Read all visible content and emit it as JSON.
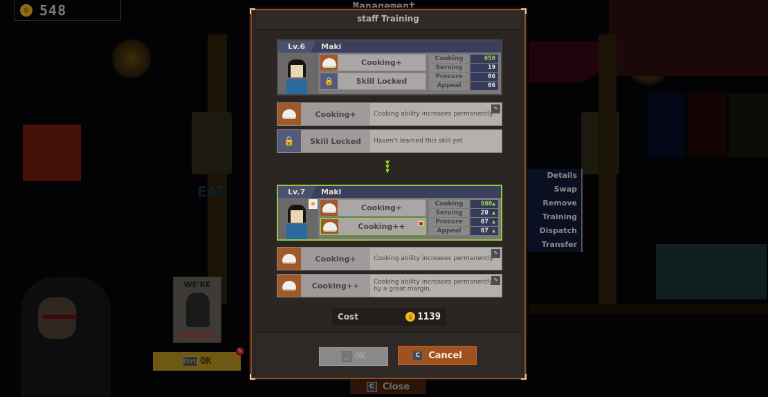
{
  "hud": {
    "coins": "548",
    "coin_icon": "$"
  },
  "background": {
    "top_title": "Management"
  },
  "modal": {
    "title": "staff Training",
    "current": {
      "level": "Lv.6",
      "name": "Maki",
      "skills": [
        {
          "label": "Cooking+",
          "icon": "steamed-bun-icon"
        },
        {
          "label": "Skill Locked",
          "icon": "lock-icon"
        }
      ],
      "stats": [
        {
          "label": "Cooking",
          "value": "650"
        },
        {
          "label": "Serving",
          "value": "19"
        },
        {
          "label": "Procure",
          "value": "06"
        },
        {
          "label": "Appeal",
          "value": "06"
        }
      ]
    },
    "current_details": [
      {
        "name": "Cooking+",
        "desc": "Cooking ability increases permanently."
      },
      {
        "name": "Skill Locked",
        "desc": "Haven't learned this skill yet"
      }
    ],
    "arrow": "»",
    "next": {
      "level": "Lv.7",
      "name": "Maki",
      "skills": [
        {
          "label": "Cooking+",
          "icon": "steamed-bun-icon"
        },
        {
          "label": "Cooking++",
          "icon": "steamed-bun-icon",
          "new": "N"
        }
      ],
      "stats": [
        {
          "label": "Cooking",
          "value": "800",
          "up": "▲"
        },
        {
          "label": "Serving",
          "value": "20",
          "up": "▲"
        },
        {
          "label": "Procure",
          "value": "07",
          "up": "▲"
        },
        {
          "label": "Appeal",
          "value": "07",
          "up": "▲"
        }
      ]
    },
    "next_details": [
      {
        "name": "Cooking+",
        "desc": "Cooking ability increases permanently."
      },
      {
        "name": "Cooking++",
        "desc": "Cooking ability increases permanently by a great margin."
      }
    ],
    "cost": {
      "label": "Cost",
      "value": "1139",
      "coin_icon": "$"
    },
    "ok": {
      "key": "⎵",
      "label": "OK"
    },
    "cancel": {
      "key": "C",
      "label": "Cancel"
    }
  },
  "close": {
    "key": "C",
    "label": "Close"
  },
  "context_menu": {
    "items": [
      "Details",
      "Swap",
      "Remove",
      "Training",
      "Dispatch",
      "Transfer"
    ]
  },
  "poster": {
    "line1": "WE'RE",
    "line2": "HIRING!"
  },
  "hire_button": {
    "key": "Ctrl",
    "label": "OK",
    "badge": "N"
  },
  "colors": {
    "accent_green": "#90cc3c",
    "cancel_orange": "#a0521e",
    "modal_border": "#8a4e22",
    "stat_value_bg": "#353a5a"
  }
}
